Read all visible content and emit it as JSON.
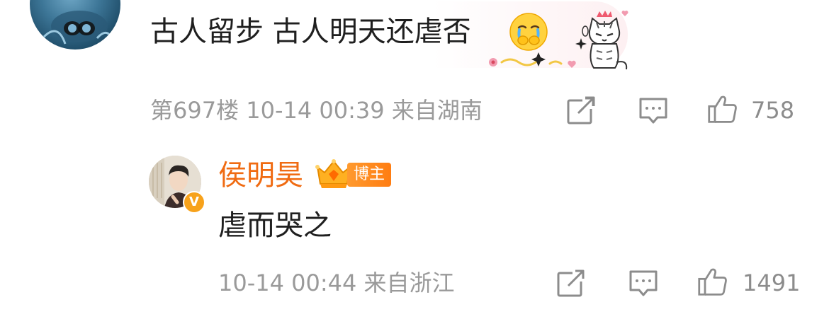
{
  "comment": {
    "text": "古人留步 古人明天还虐否",
    "emoji": "crying-emoji",
    "sticker": "cat-sticker",
    "meta": {
      "floor": "第697楼",
      "date": "10-14 00:39",
      "location": "来自湖南"
    },
    "likes": "758"
  },
  "reply": {
    "username": "侯明昊",
    "badge_label": "博主",
    "verified_mark": "V",
    "text": "虐而哭之",
    "meta": {
      "date": "10-14 00:44",
      "location": "来自浙江"
    },
    "likes": "1491"
  },
  "icons": {
    "share": "share-icon",
    "comment": "comment-icon",
    "like": "thumbs-up-icon"
  },
  "colors": {
    "username": "#f06b12",
    "badge": "#ff8a1f",
    "meta_text": "#9a9a9a",
    "verified": "#f7a21b"
  }
}
